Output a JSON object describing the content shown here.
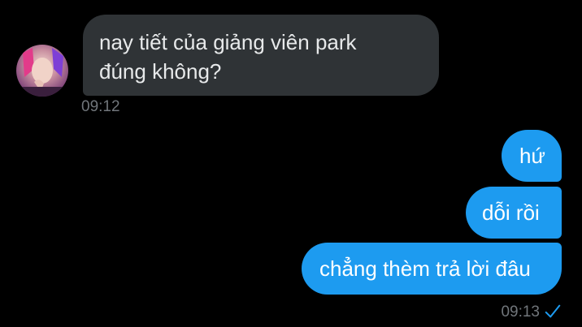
{
  "conversation": {
    "incoming": {
      "lines": [
        "nay tiết của giảng viên park",
        "đúng không?"
      ],
      "time": "09:12",
      "avatar_icon": "user-avatar"
    },
    "outgoing": {
      "messages": [
        "hứ",
        "dỗi rồi",
        "chẳng thèm trả lời đâu"
      ],
      "time": "09:13",
      "status_icon": "sent-check-icon"
    }
  },
  "colors": {
    "background": "#000000",
    "incoming_bubble": "#2f3336",
    "outgoing_bubble": "#1d9bf0",
    "timestamp": "#71767b"
  }
}
